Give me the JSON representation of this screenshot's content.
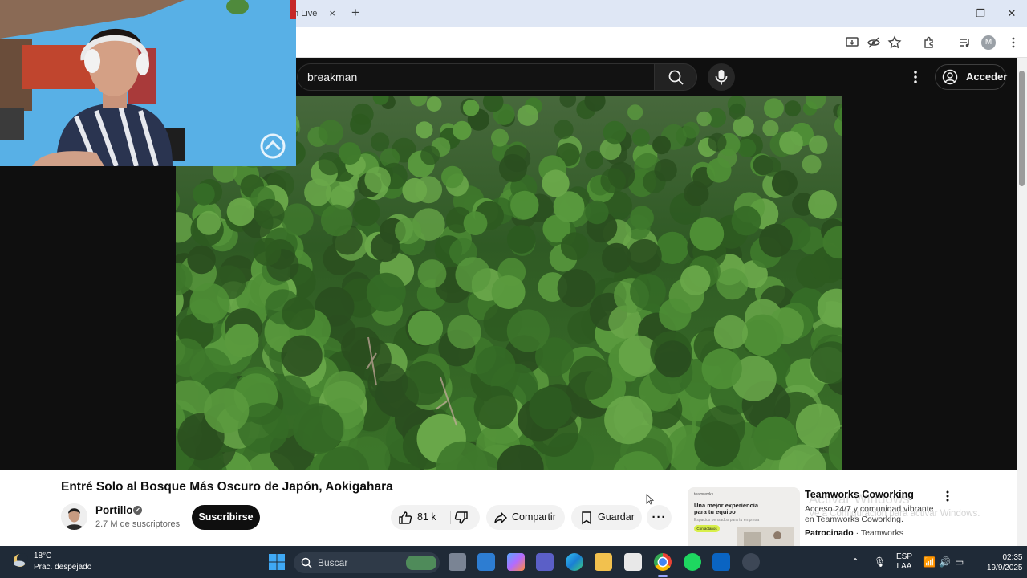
{
  "browser": {
    "tab_title": "h Live",
    "tab_close": "×",
    "new_tab": "+",
    "window_controls": [
      "—",
      "❐",
      "✕"
    ],
    "profile_initial": "M"
  },
  "youtube": {
    "search_query": "breakman",
    "signin_label": "Acceder"
  },
  "video": {
    "title": "Entré Solo al Bosque Más Oscuro de Japón, Aokigahara",
    "channel_name": "Portillo",
    "verified_mark": "✔",
    "subscribers": "2.7 M de suscriptores",
    "subscribe_label": "Suscribirse",
    "likes": "81 k",
    "share_label": "Compartir",
    "save_label": "Guardar",
    "more_label": "···"
  },
  "ad": {
    "thumb_brand": "teamworks",
    "thumb_headline": "Una mejor experiencia para tu equipo",
    "thumb_sub": "Espacios pensados para tu empresa",
    "thumb_cta": "Contáctanos",
    "title": "Teamworks Coworking",
    "description": "Acceso 24/7 y comunidad vibrante en Teamworks Coworking.",
    "sponsored_label": "Patrocinado",
    "sponsor_sep": "·",
    "advertiser": "Teamworks"
  },
  "watermark": {
    "line1": "Activar Windows",
    "line2": "Ve a Configuración para activar Windows."
  },
  "taskbar": {
    "temperature": "18°C",
    "weather": "Prac. despejado",
    "search_placeholder": "Buscar",
    "lang_1": "ESP",
    "lang_2": "LAA",
    "time": "02:35",
    "date": "19/9/2025"
  }
}
